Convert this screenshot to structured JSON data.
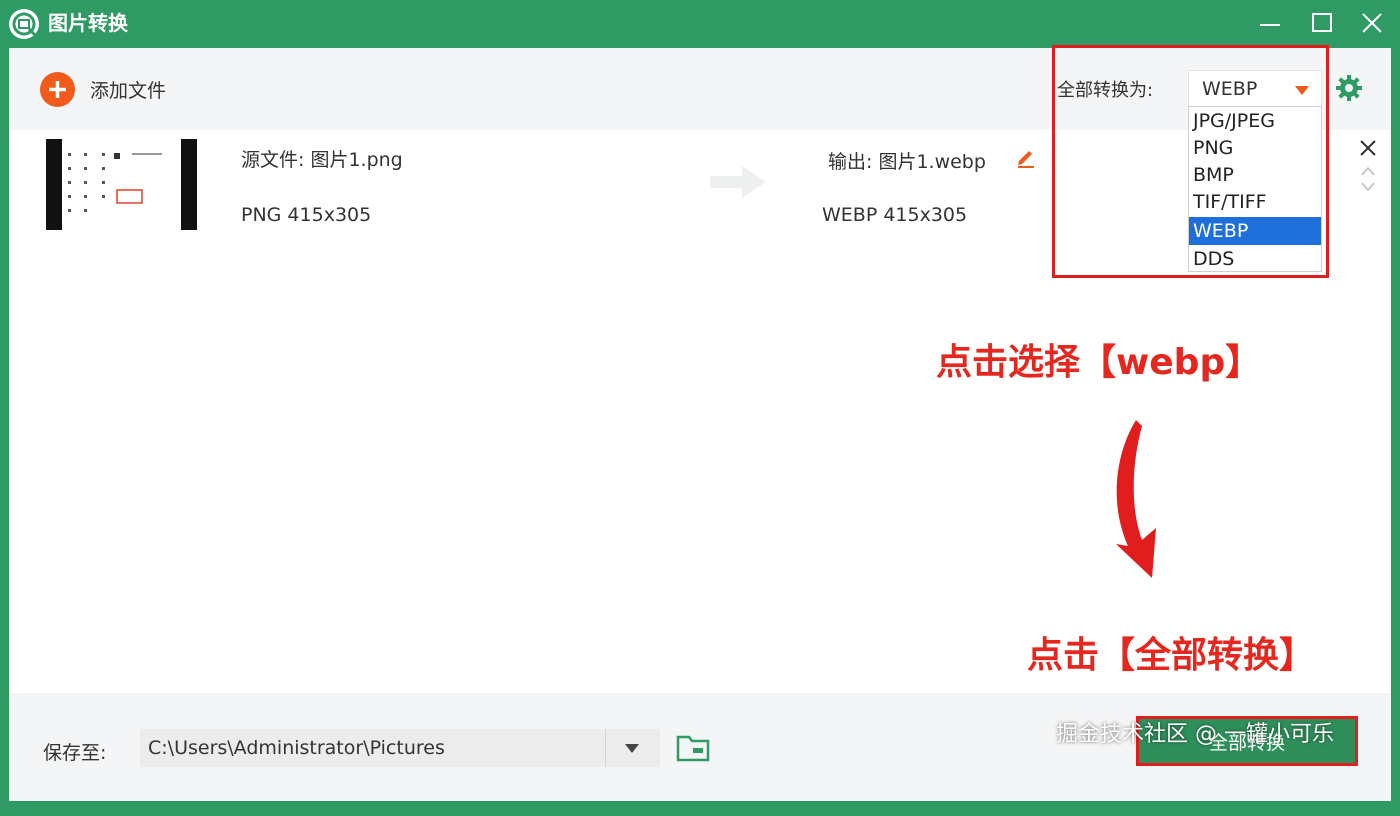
{
  "app": {
    "title": "图片转换"
  },
  "toolbar": {
    "add_file_label": "添加文件",
    "convert_all_label": "全部转换为:",
    "selected_format": "WEBP"
  },
  "formats": [
    "JPG/JPEG",
    "PNG",
    "BMP",
    "TIF/TIFF",
    "WEBP",
    "DDS"
  ],
  "file": {
    "source_label": "源文件: 图片1.png",
    "source_info": "PNG   415x305",
    "output_label": "输出: 图片1.webp",
    "output_info": "WEBP   415x305"
  },
  "annotations": {
    "select_webp": "点击选择【webp】",
    "click_convert": "点击【全部转换】"
  },
  "bottom": {
    "save_label": "保存至:",
    "save_path": "C:\\Users\\Administrator\\Pictures",
    "convert_button": "全部转换"
  },
  "watermark": "掘金技术社区 @ 一罐小可乐",
  "colors": {
    "brand_green": "#2f9a63",
    "accent_orange": "#f05a1a",
    "annotation_red": "#e5281f",
    "selection_blue": "#1e6fd9"
  }
}
